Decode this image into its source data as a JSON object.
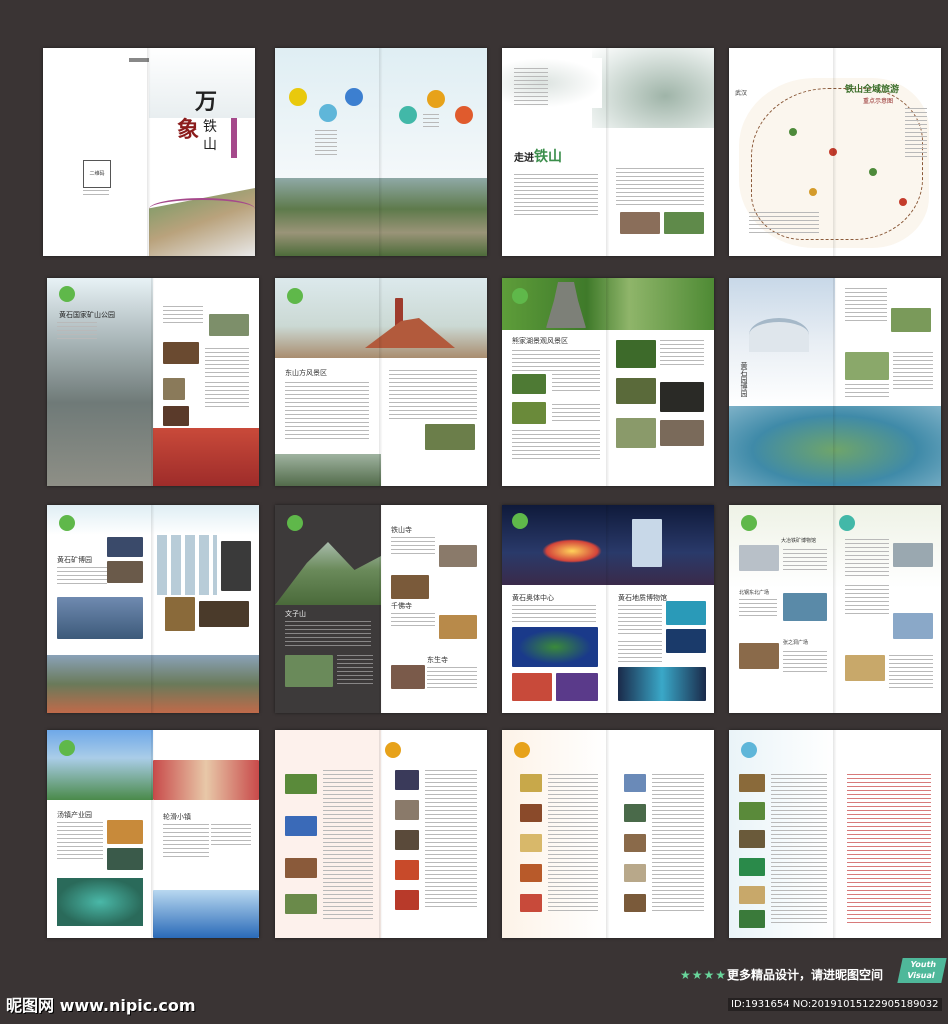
{
  "cover": {
    "wan": "万",
    "xiang": "象",
    "tieshan": "铁山",
    "qr_label": "二维码"
  },
  "intro_spread": {
    "title": "走进",
    "title_brush": "铁山"
  },
  "map_spread": {
    "title": "铁山全域旅游",
    "subtitle": "重点示意图",
    "label_wuhan": "武汉"
  },
  "sections": {
    "mine_park": "黄石国家矿山公园",
    "dongfang_mountain": "东山方风景区",
    "bronze_scenic": "熊家湖景观风景区",
    "huangshi_park": "黄石园博园",
    "mine_museum": "黄石矿博园",
    "wenfeng": "文子山",
    "tieshan_temple": "铁山寺",
    "xianyao_temple": "千佛寺",
    "dongsheng": "东生寺",
    "sports_center": "黄石奥体中心",
    "geology_museum": "黄石地质博物馆",
    "industry_park": "大冶铁矿博物馆",
    "square_north": "北钢东北广场",
    "square_east": "张之洞广场",
    "tangshi_industry": "汤镇产业园",
    "snow_town": "轮滑小镇"
  },
  "footer": {
    "stars": "★★★★",
    "ad_text": "更多精品设计，请进昵图空间",
    "badge_line1": "Youth",
    "badge_line2": "Visual",
    "site_logo": "昵图网 www.nipic.com",
    "image_id": "ID:1931654 NO:20191015122905189032"
  }
}
